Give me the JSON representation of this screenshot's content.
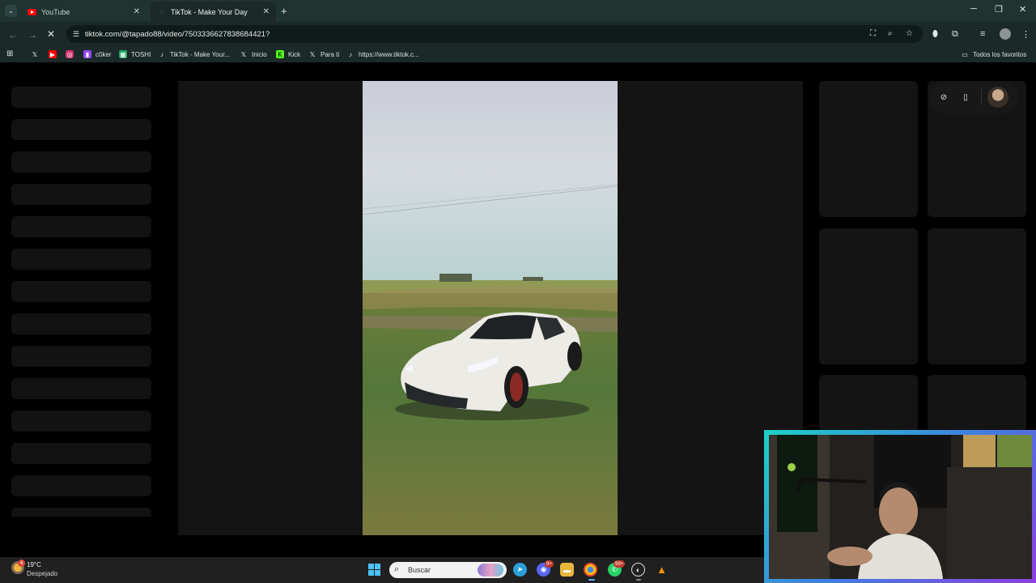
{
  "browser": {
    "tabs": [
      {
        "title": "YouTube",
        "icon": "youtube-icon",
        "active": false
      },
      {
        "title": "TikTok - Make Your Day",
        "icon": "tiktok-icon",
        "active": true
      }
    ],
    "url": "tiktok.com/@tapado88/video/7503336627838684421?",
    "bookmarks": [
      {
        "label": "",
        "icon": "x-icon"
      },
      {
        "label": "",
        "icon": "youtube-icon"
      },
      {
        "label": "",
        "icon": "instagram-icon"
      },
      {
        "label": "c0ker",
        "icon": "twitch-icon"
      },
      {
        "label": "TOSHI",
        "icon": "sheets-icon"
      },
      {
        "label": "TikTok - Make Your...",
        "icon": "tiktok-icon"
      },
      {
        "label": "Inicio",
        "icon": "x-icon"
      },
      {
        "label": "Kick",
        "icon": "kick-icon"
      },
      {
        "label": "Para ti",
        "icon": "x-icon"
      },
      {
        "label": "https://www.tiktok.c...",
        "icon": "tiktok-icon"
      }
    ],
    "all_bookmarks": "Todos los favoritos"
  },
  "taskbar": {
    "weather": {
      "temp": "19°C",
      "desc": "Despejado",
      "badge": "4"
    },
    "search_placeholder": "Buscar",
    "badges": {
      "discord": "9+",
      "whatsapp": "99+"
    }
  },
  "colors": {
    "chrome_bg": "#1b2928",
    "tabstrip_bg": "#1f3331",
    "page_bg": "#000000",
    "skeleton": "#121212",
    "panel": "#141414",
    "cam_border": "#3f7fe0"
  }
}
